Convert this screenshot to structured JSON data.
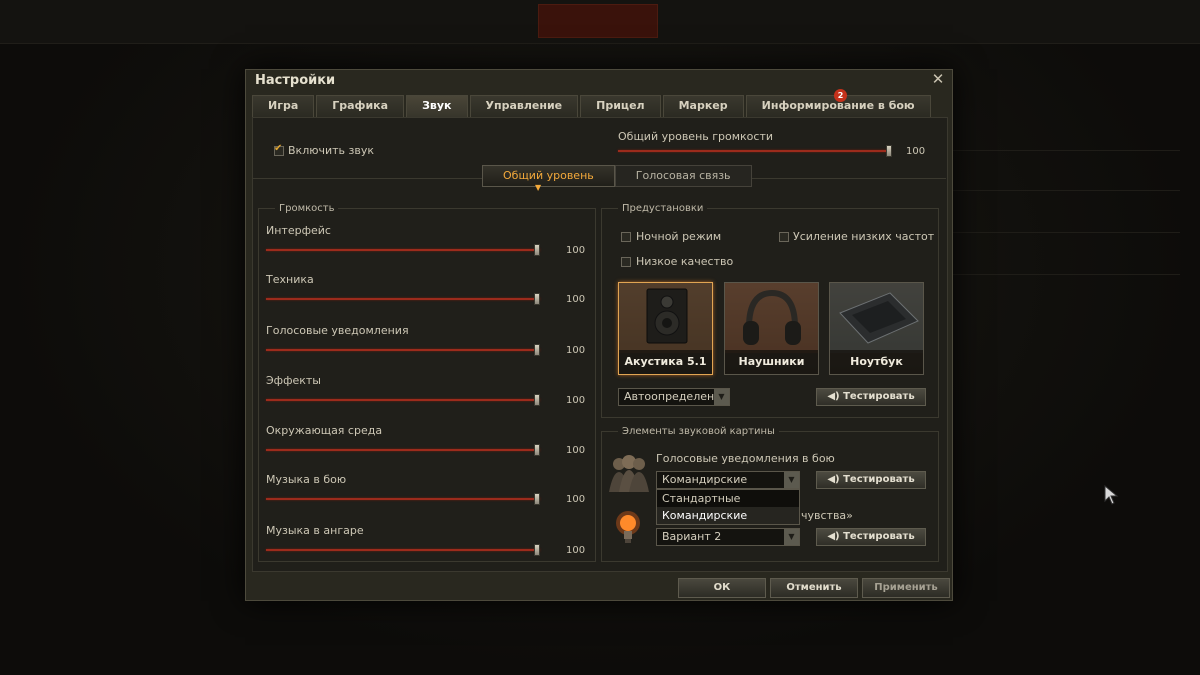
{
  "window": {
    "title": "Настройки"
  },
  "tabs": [
    {
      "label": "Игра"
    },
    {
      "label": "Графика"
    },
    {
      "label": "Звук",
      "active": true
    },
    {
      "label": "Управление"
    },
    {
      "label": "Прицел"
    },
    {
      "label": "Маркер"
    },
    {
      "label": "Информирование в бою",
      "badge": "2"
    }
  ],
  "general": {
    "enable_sound_label": "Включить звук",
    "enable_sound_checked": true,
    "master_volume_label": "Общий уровень громкости",
    "master_volume_value": "100",
    "master_volume_level": 1.0
  },
  "subtabs": [
    {
      "label": "Общий уровень",
      "active": true
    },
    {
      "label": "Голосовая связь"
    }
  ],
  "volume": {
    "group_label": "Громкость",
    "items": [
      {
        "label": "Интерфейс",
        "value": "100",
        "level": 1.0
      },
      {
        "label": "Техника",
        "value": "100",
        "level": 1.0
      },
      {
        "label": "Голосовые уведомления",
        "value": "100",
        "level": 1.0
      },
      {
        "label": "Эффекты",
        "value": "100",
        "level": 1.0
      },
      {
        "label": "Окружающая среда",
        "value": "100",
        "level": 1.0
      },
      {
        "label": "Музыка в бою",
        "value": "100",
        "level": 1.0
      },
      {
        "label": "Музыка в ангаре",
        "value": "100",
        "level": 1.0
      }
    ]
  },
  "presets": {
    "group_label": "Предустановки",
    "night_mode": "Ночной режим",
    "bass_boost": "Усиление низких частот",
    "low_quality": "Низкое качество",
    "devices": [
      {
        "label": "Акустика 5.1",
        "icon": "speaker-icon",
        "selected": true
      },
      {
        "label": "Наушники",
        "icon": "headphones-icon"
      },
      {
        "label": "Ноутбук",
        "icon": "laptop-icon"
      }
    ],
    "autodetect": "Автоопределение",
    "test_label": "Тестировать"
  },
  "sound_elements": {
    "group_label": "Элементы звуковой картины",
    "voice_label": "Голосовые уведомления в бою",
    "voice_value": "Командирские",
    "voice_options": [
      "Стандартные",
      "Командирские"
    ],
    "sixth_sense_label_tail": "чувства»",
    "sixth_sense_value": "Вариант 2",
    "test_label": "Тестировать"
  },
  "footer": {
    "ok": "ОК",
    "cancel": "Отменить",
    "apply": "Применить"
  },
  "colors": {
    "accent": "#f3a93b",
    "slider": "#9c2b1c",
    "badge": "#c4311b"
  }
}
